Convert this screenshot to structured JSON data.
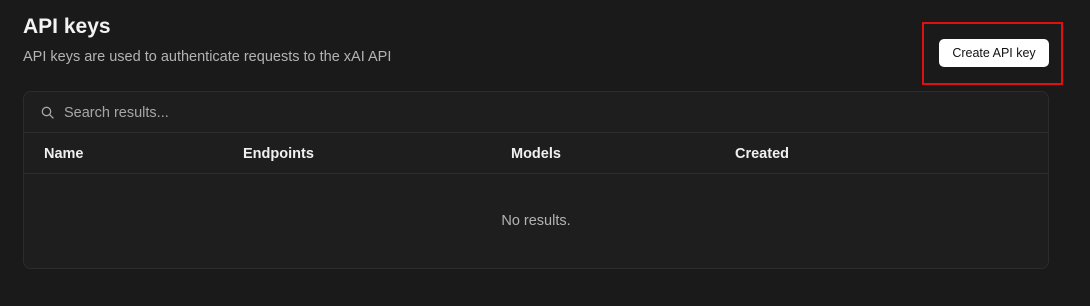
{
  "header": {
    "title": "API keys",
    "subtitle": "API keys are used to authenticate requests to the xAI API",
    "create_button_label": "Create API key"
  },
  "search": {
    "icon": "search-icon",
    "placeholder": "Search results...",
    "value": ""
  },
  "table": {
    "columns": [
      "Name",
      "Endpoints",
      "Models",
      "Created"
    ],
    "rows": [],
    "empty_message": "No results."
  },
  "colors": {
    "background": "#1a1a1a",
    "card": "#1e1e1e",
    "highlight": "#e01010",
    "button_bg": "#ffffff"
  }
}
